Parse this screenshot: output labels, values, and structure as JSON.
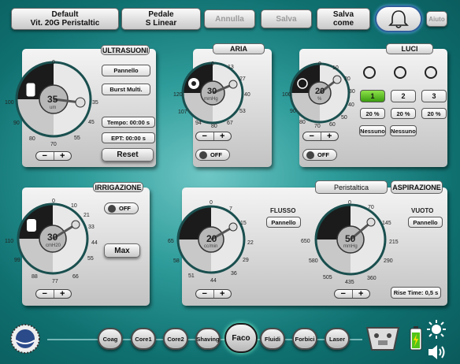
{
  "topbar": {
    "default_line1": "Default",
    "default_line2": "Vit. 20G Peristaltic",
    "pedal_line1": "Pedale",
    "pedal_line2": "S Linear",
    "cancel": "Annulla",
    "save": "Salva",
    "save_as_line1": "Salva",
    "save_as_line2": "come",
    "help": "Aiuto",
    "bell_icon": "bell-icon"
  },
  "ultrasound": {
    "title": "ULTRASUONI",
    "value": "35",
    "unit": "um",
    "ticks": {
      "t0": "0",
      "t35": "35",
      "t100": "100",
      "t90": "90",
      "t80": "80",
      "t70": "70",
      "t55": "55",
      "t45": "45"
    },
    "mode_button": "Pannello",
    "burst_button": "Burst Multi.",
    "time_label": "Tempo: 00:00 s",
    "ept_label": "EPT: 00:00 s",
    "reset": "Reset",
    "level": 0.35,
    "minus": "−",
    "plus": "+"
  },
  "air": {
    "title": "ARIA",
    "value": "30",
    "unit": "mmHg",
    "ticks": {
      "t0": "0",
      "t13": "13",
      "t27": "27",
      "t40": "40",
      "t53": "53",
      "t67": "67",
      "t80": "80",
      "t94": "94",
      "t107": "107",
      "t120": "120"
    },
    "toggle": "OFF",
    "minus": "−",
    "plus": "+"
  },
  "lights": {
    "title": "LUCI",
    "value": "20",
    "unit": "%",
    "ticks": {
      "t0": "0",
      "t10": "10",
      "t20": "20",
      "t30": "30",
      "t40": "40",
      "t50": "50",
      "t60": "60",
      "t70": "70",
      "t80": "80",
      "t90": "90",
      "t100": "100"
    },
    "channels": [
      "1",
      "2",
      "3"
    ],
    "percents": [
      "20 %",
      "20 %",
      "20 %"
    ],
    "none_labels": [
      "Nessuno",
      "Nessuno"
    ],
    "toggle": "OFF",
    "minus": "−",
    "plus": "+"
  },
  "irrigation": {
    "title": "IRRIGAZIONE",
    "value": "30",
    "unit": "cmH20",
    "ticks": {
      "t0": "0",
      "t10": "10",
      "t21": "21",
      "t33": "33",
      "t44": "44",
      "t55": "55",
      "t66": "66",
      "t77": "77",
      "t88": "88",
      "t99": "99",
      "t110": "110"
    },
    "toggle": "OFF",
    "max": "Max",
    "minus": "−",
    "plus": "+"
  },
  "aspiration": {
    "tab_peristaltic": "Peristaltica",
    "title": "ASPIRAZIONE",
    "flow_label": "FLUSSO",
    "flow_button": "Pannello",
    "flow_value": "20",
    "flow_unit": "cc/min",
    "flow_ticks": {
      "t0": "0",
      "t7": "7",
      "t15": "15",
      "t22": "22",
      "t29": "29",
      "t36": "36",
      "t44": "44",
      "t51": "51",
      "t58": "58",
      "t65": "65"
    },
    "vac_label": "VUOTO",
    "vac_button": "Pannello",
    "vac_value": "50",
    "vac_unit": "mmHg",
    "vac_ticks": {
      "t0": "0",
      "t70": "70",
      "t145": "145",
      "t215": "215",
      "t290": "290",
      "t360": "360",
      "t435": "435",
      "t505": "505",
      "t580": "580",
      "t650": "650"
    },
    "rise_time": "Rise Time: 0,5 s",
    "minus": "−",
    "plus": "+"
  },
  "tools": [
    "Coag",
    "Core1",
    "Core2",
    "Shaving",
    "Faco",
    "Fluidi",
    "Forbici",
    "Laser"
  ],
  "accent": "#0f6f6f"
}
